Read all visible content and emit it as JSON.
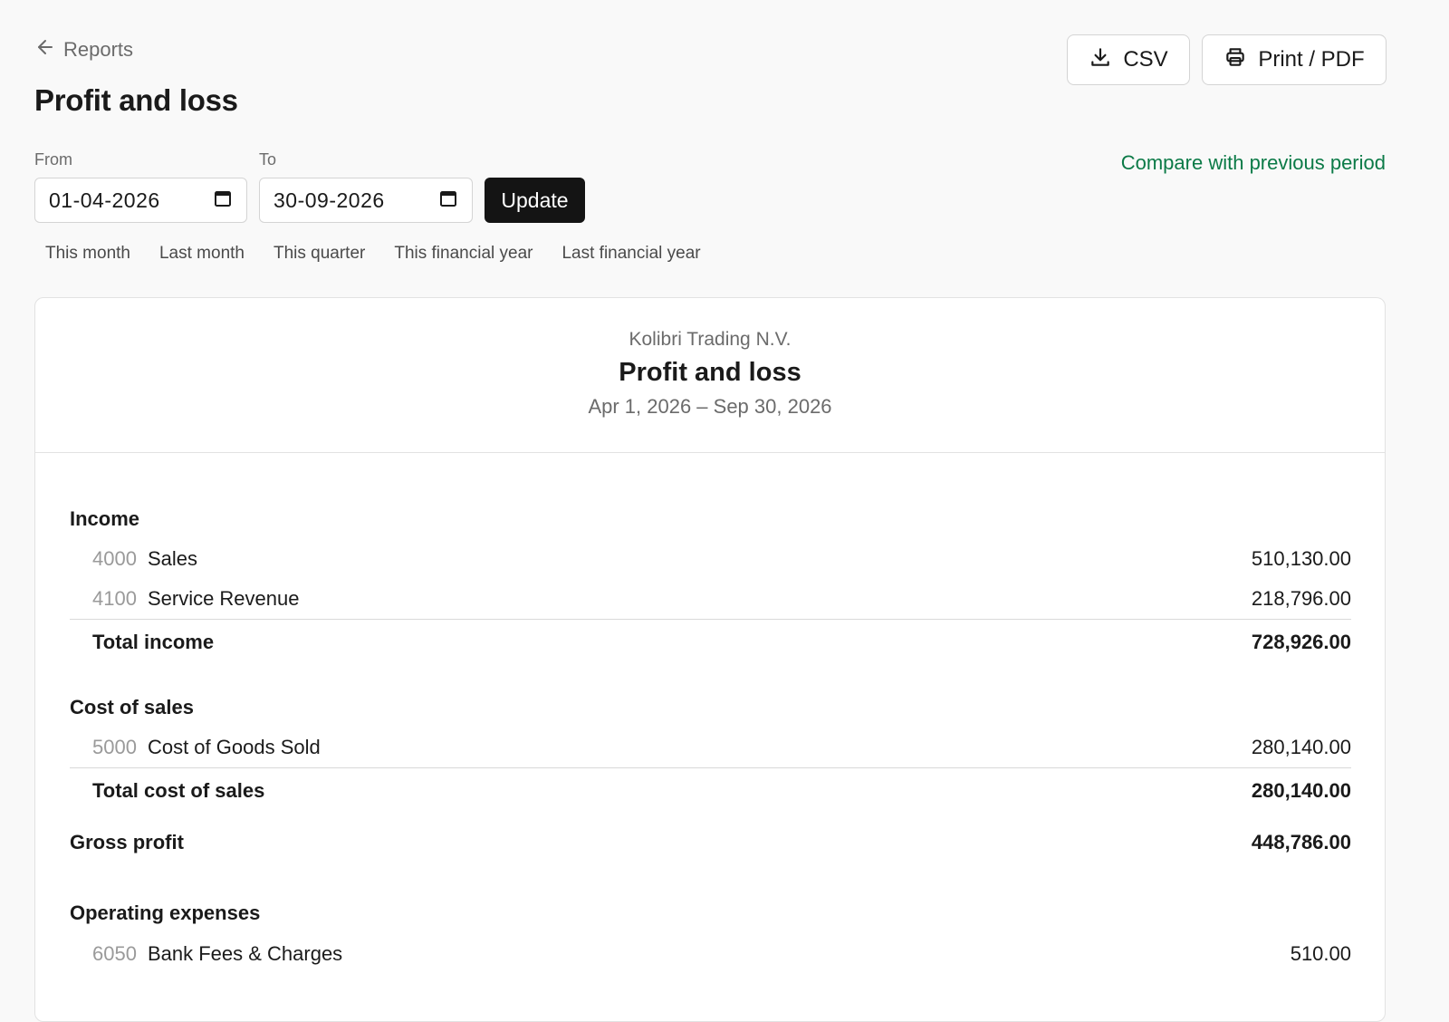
{
  "header": {
    "back_label": "Reports",
    "page_title": "Profit and loss",
    "csv_label": "CSV",
    "print_label": "Print / PDF"
  },
  "filters": {
    "from_label": "From",
    "to_label": "To",
    "from_value": "01-04-2026",
    "to_value": "30-09-2026",
    "update_label": "Update",
    "compare_label": "Compare with previous period",
    "presets": [
      "This month",
      "Last month",
      "This quarter",
      "This financial year",
      "Last financial year"
    ]
  },
  "report": {
    "company": "Kolibri Trading N.V.",
    "title": "Profit and loss",
    "period": "Apr 1, 2026 – Sep 30, 2026",
    "income": {
      "title": "Income",
      "lines": [
        {
          "code": "4000",
          "name": "Sales",
          "amount": "510,130.00"
        },
        {
          "code": "4100",
          "name": "Service Revenue",
          "amount": "218,796.00"
        }
      ],
      "total_label": "Total income",
      "total_amount": "728,926.00"
    },
    "cost_of_sales": {
      "title": "Cost of sales",
      "lines": [
        {
          "code": "5000",
          "name": "Cost of Goods Sold",
          "amount": "280,140.00"
        }
      ],
      "total_label": "Total cost of sales",
      "total_amount": "280,140.00"
    },
    "gross_profit": {
      "label": "Gross profit",
      "amount": "448,786.00"
    },
    "operating_expenses": {
      "title": "Operating expenses",
      "lines": [
        {
          "code": "6050",
          "name": "Bank Fees & Charges",
          "amount": "510.00"
        }
      ]
    }
  },
  "colors": {
    "accent_link": "#0b7a47",
    "primary_button": "#141414"
  }
}
